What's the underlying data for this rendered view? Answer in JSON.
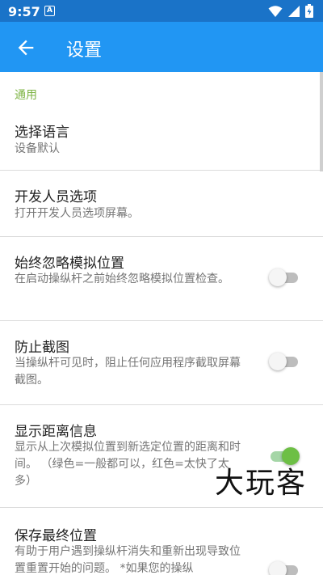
{
  "status_bar": {
    "time": "9:57",
    "notification_letter": "A"
  },
  "app_bar": {
    "title": "设置"
  },
  "section": {
    "title": "通用"
  },
  "prefs": [
    {
      "title": "选择语言",
      "summary": "设备默认"
    },
    {
      "title": "开发人员选项",
      "summary": "打开开发人员选项屏幕。"
    },
    {
      "title": "始终忽略模拟位置",
      "summary": "在启动操纵杆之前始终忽略模拟位置检查。",
      "switch_on": false
    },
    {
      "title": "防止截图",
      "summary": "当操纵杆可见时，阻止任何应用程序截取屏幕截图。",
      "switch_on": false
    },
    {
      "title": "显示距离信息",
      "summary": "显示从上次模拟位置到新选定位置的距离和时间。 （绿色=一般都可以，红色=太快了太多）",
      "switch_on": true
    },
    {
      "title": "保存最终位置",
      "summary": "有助于用户遇到操纵杆消失和重新出现导致位置重置开始的问题。 *如果您的操纵",
      "switch_on": false
    }
  ],
  "watermark": {
    "text": "大玩客"
  },
  "colors": {
    "app_bar": "#2196f3",
    "status_bar": "#1a73c8",
    "section_accent": "#7cb342",
    "switch_on": "#6dbf45"
  }
}
